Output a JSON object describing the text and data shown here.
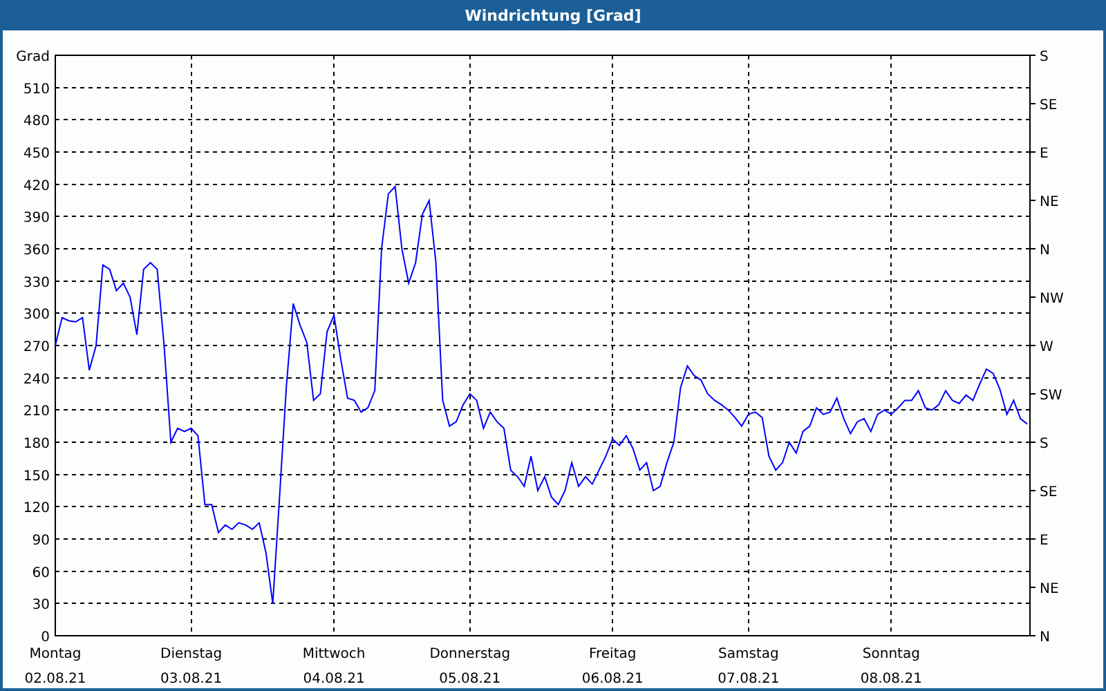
{
  "chart_data": {
    "type": "line",
    "title": "Windrichtung [Grad]",
    "ylabel": "Grad",
    "ylim": [
      0,
      540
    ],
    "grid": true,
    "categories": [
      "Montag",
      null,
      null,
      null,
      null,
      null,
      null,
      null,
      null,
      null,
      null,
      null,
      null,
      null,
      null,
      null,
      null,
      null,
      null,
      null,
      "Dienstag",
      null,
      null,
      null,
      null,
      null,
      null,
      null,
      null,
      null,
      null,
      null,
      null,
      null,
      null,
      null,
      null,
      null,
      null,
      null,
      null,
      "Mittwoch",
      null,
      null,
      null,
      null,
      null,
      null,
      null,
      null,
      null,
      null,
      null,
      null,
      null,
      null,
      null,
      null,
      null,
      null,
      null,
      "Donnerstag",
      null,
      null,
      null,
      null,
      null,
      null,
      null,
      null,
      null,
      null,
      null,
      null,
      null,
      null,
      null,
      null,
      null,
      null,
      null,
      null,
      "Freitag",
      null,
      null,
      null,
      null,
      null,
      null,
      null,
      null,
      null,
      null,
      null,
      null,
      null,
      null,
      null,
      null,
      null,
      null,
      null,
      "Samstag",
      null,
      null,
      null,
      null,
      null,
      null,
      null,
      null,
      null,
      null,
      null,
      null,
      null,
      null,
      null,
      null,
      null,
      null,
      null,
      null,
      "Sonntag",
      null,
      null,
      null,
      null,
      null,
      null,
      null,
      null,
      null,
      null,
      null,
      null,
      null,
      null,
      null,
      null,
      null,
      null,
      null,
      null
    ],
    "yticks": [
      0,
      30,
      60,
      90,
      120,
      150,
      180,
      210,
      240,
      270,
      300,
      330,
      360,
      390,
      420,
      450,
      480,
      510
    ],
    "series": [
      {
        "color": "#0000ff",
        "values": [
          270,
          296,
          293,
          292,
          296,
          247,
          270,
          345,
          341,
          321,
          328,
          315,
          280,
          341,
          347,
          341,
          270,
          180,
          193,
          190,
          193,
          186,
          122,
          122,
          96,
          103,
          99,
          105,
          103,
          99,
          105,
          77,
          30,
          129,
          231,
          309,
          289,
          273,
          219,
          225,
          283,
          298,
          257,
          221,
          219,
          208,
          212,
          228,
          360,
          411,
          418,
          360,
          328,
          347,
          392,
          405,
          347,
          219,
          195,
          199,
          215,
          225,
          219,
          193,
          208,
          199,
          193,
          154,
          148,
          139,
          167,
          135,
          148,
          129,
          122,
          135,
          161,
          139,
          148,
          141,
          154,
          167,
          183,
          177,
          186,
          174,
          154,
          161,
          135,
          139,
          161,
          180,
          231,
          251,
          242,
          238,
          225,
          219,
          215,
          210,
          203,
          195,
          206,
          208,
          203,
          167,
          154,
          161,
          180,
          170,
          190,
          195,
          212,
          206,
          208,
          221,
          202,
          188,
          199,
          202,
          190,
          206,
          210,
          206,
          212,
          219,
          219,
          228,
          212,
          210,
          215,
          228,
          219,
          216,
          224,
          219,
          234,
          248,
          244,
          229,
          206,
          219,
          202,
          197
        ]
      }
    ]
  },
  "x_axis_dates": [
    "02.08.21",
    "03.08.21",
    "04.08.21",
    "05.08.21",
    "06.08.21",
    "07.08.21",
    "08.08.21"
  ],
  "right_axis_labels": [
    "S",
    "SE",
    "E",
    "NE",
    "N",
    "NW",
    "W",
    "SW",
    "S",
    "SE",
    "E",
    "NE",
    "N"
  ]
}
